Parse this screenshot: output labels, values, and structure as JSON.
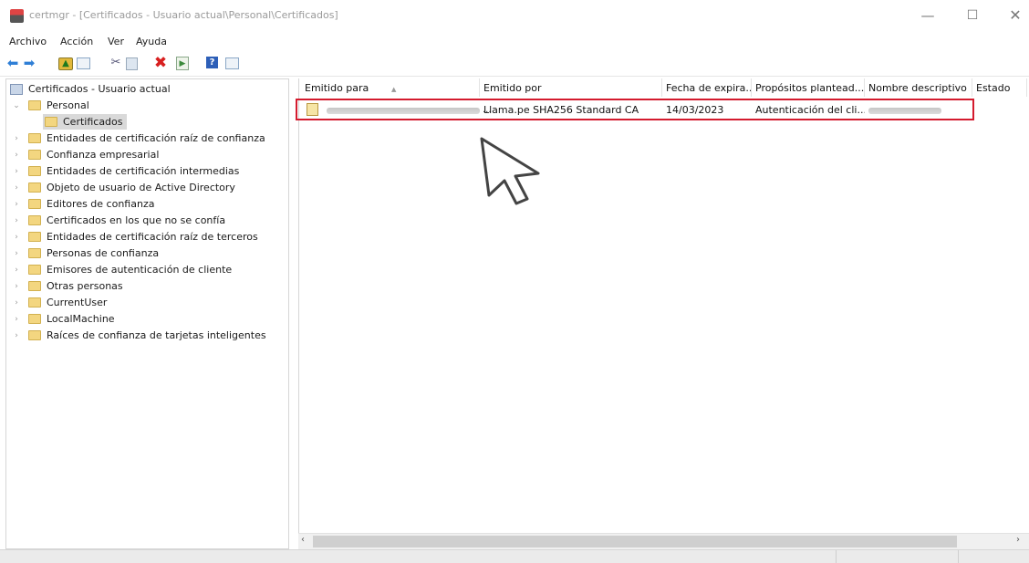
{
  "window": {
    "title": "certmgr - [Certificados - Usuario actual\\Personal\\Certificados]",
    "minimize_glyph": "—",
    "maximize_glyph": "☐",
    "close_glyph": "✕"
  },
  "menu": [
    "Archivo",
    "Acción",
    "Ver",
    "Ayuda"
  ],
  "toolbar": {
    "icons": [
      "back-arrow-icon",
      "forward-arrow-icon",
      "up-folder-icon",
      "show-hide-tree-icon",
      "cut-icon",
      "copy-icon",
      "delete-icon",
      "export-list-icon",
      "help-icon",
      "properties-icon"
    ]
  },
  "tree": {
    "root": "Certificados - Usuario actual",
    "items": [
      {
        "label": "Personal",
        "expanded": true,
        "children": [
          "Certificados"
        ]
      },
      {
        "label": "Entidades de certificación raíz de confianza"
      },
      {
        "label": "Confianza empresarial"
      },
      {
        "label": "Entidades de certificación intermedias"
      },
      {
        "label": "Objeto de usuario de Active Directory"
      },
      {
        "label": "Editores de confianza"
      },
      {
        "label": "Certificados en los que no se confía"
      },
      {
        "label": "Entidades de certificación raíz de terceros"
      },
      {
        "label": "Personas de confianza"
      },
      {
        "label": "Emisores de autenticación de cliente"
      },
      {
        "label": "Otras personas"
      },
      {
        "label": "CurrentUser"
      },
      {
        "label": "LocalMachine"
      },
      {
        "label": "Raíces de confianza de tarjetas inteligentes"
      }
    ],
    "selected": "Certificados"
  },
  "list": {
    "columns": [
      "Emitido para",
      "Emitido por",
      "Fecha de expira...",
      "Propósitos plantead...",
      "Nombre descriptivo",
      "Estado"
    ],
    "rows": [
      {
        "issued_to": "",
        "issued_by": "Llama.pe SHA256 Standard CA",
        "expiration": "14/03/2023",
        "purposes": "Autenticación del cli...",
        "friendly_name": "",
        "status": ""
      }
    ]
  },
  "colors": {
    "highlight_border": "#d41b2e",
    "folder": "#f3d680",
    "selected_bg": "#d9d9d9"
  }
}
